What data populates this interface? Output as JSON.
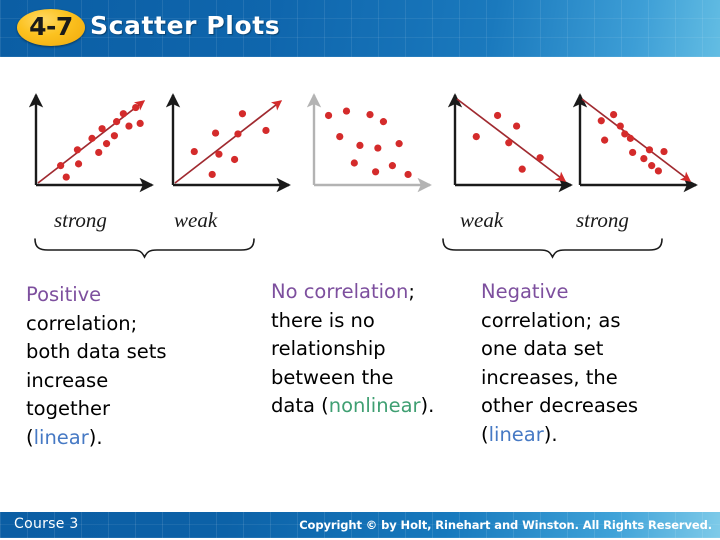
{
  "header": {
    "badge": "4-7",
    "title": "Scatter Plots",
    "badge_color": "#fcc220",
    "bar_color": "#0b5ea4"
  },
  "plots": [
    {
      "name": "strong-positive",
      "correlation": "strong positive",
      "trend": "up",
      "axis_color": "#1a1a1a",
      "dot_color": "#d42b2b",
      "points": [
        [
          22,
          78
        ],
        [
          27,
          91
        ],
        [
          37,
          60
        ],
        [
          38,
          76
        ],
        [
          50,
          47
        ],
        [
          56,
          63
        ],
        [
          59,
          36
        ],
        [
          63,
          53
        ],
        [
          70,
          44
        ],
        [
          72,
          28
        ],
        [
          78,
          19
        ],
        [
          83,
          33
        ],
        [
          89,
          12
        ],
        [
          93,
          30
        ]
      ]
    },
    {
      "name": "weak-positive",
      "correlation": "weak positive",
      "trend": "up",
      "axis_color": "#1a1a1a",
      "dot_color": "#d42b2b",
      "points": [
        [
          19,
          62
        ],
        [
          35,
          88
        ],
        [
          38,
          41
        ],
        [
          41,
          65
        ],
        [
          55,
          71
        ],
        [
          58,
          42
        ],
        [
          62,
          19
        ],
        [
          83,
          38
        ]
      ]
    },
    {
      "name": "no-correlation",
      "correlation": "none",
      "trend": "none",
      "axis_color": "#b3b3b3",
      "dot_color": "#d42b2b",
      "points": [
        [
          13,
          21
        ],
        [
          23,
          45
        ],
        [
          29,
          16
        ],
        [
          36,
          75
        ],
        [
          41,
          55
        ],
        [
          50,
          20
        ],
        [
          55,
          85
        ],
        [
          57,
          58
        ],
        [
          62,
          28
        ],
        [
          70,
          78
        ],
        [
          76,
          53
        ],
        [
          84,
          88
        ]
      ]
    },
    {
      "name": "weak-negative",
      "correlation": "weak negative",
      "trend": "down",
      "axis_color": "#1a1a1a",
      "dot_color": "#d42b2b",
      "points": [
        [
          19,
          45
        ],
        [
          38,
          21
        ],
        [
          48,
          52
        ],
        [
          55,
          33
        ],
        [
          60,
          82
        ],
        [
          76,
          69
        ]
      ]
    },
    {
      "name": "strong-negative",
      "correlation": "strong negative",
      "trend": "down",
      "axis_color": "#1a1a1a",
      "dot_color": "#d42b2b",
      "points": [
        [
          19,
          27
        ],
        [
          22,
          49
        ],
        [
          30,
          20
        ],
        [
          36,
          33
        ],
        [
          40,
          42
        ],
        [
          45,
          47
        ],
        [
          47,
          63
        ],
        [
          57,
          70
        ],
        [
          62,
          60
        ],
        [
          64,
          78
        ],
        [
          70,
          84
        ],
        [
          75,
          62
        ]
      ]
    }
  ],
  "braces": {
    "left": {
      "start_label": "strong",
      "end_label": "weak"
    },
    "right": {
      "start_label": "weak",
      "end_label": "strong"
    }
  },
  "captions": {
    "positive": {
      "highlight": "Positive",
      "body_1": "correlation;",
      "body_2": "both data sets",
      "body_3": "increase",
      "body_4": "together",
      "paren_open": "(",
      "term": "linear",
      "paren_close": ")."
    },
    "none": {
      "highlight": "No correlation",
      "semicolon": ";",
      "body_1": "there is no",
      "body_2": "relationship",
      "body_3": "between the",
      "body_4": "data ",
      "paren_open": "(",
      "term": "nonlinear",
      "paren_close": ")."
    },
    "negative": {
      "highlight": "Negative",
      "body_1": "correlation; as",
      "body_2": "one data set",
      "body_3": "increases, the",
      "body_4": "other decreases",
      "paren_open": "(",
      "term": "linear",
      "paren_close": ")."
    }
  },
  "footer": {
    "course": "Course 3",
    "copyright": "Copyright © by Holt, Rinehart and Winston. All Rights Reserved."
  }
}
